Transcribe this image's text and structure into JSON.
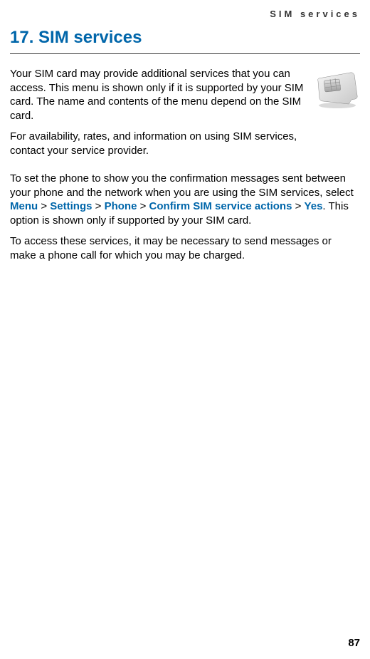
{
  "header": {
    "section_label": "SIM services"
  },
  "title": "17. SIM services",
  "paragraphs": {
    "p1": "Your SIM card may provide additional services that you can access. This menu is shown only if it is supported by your SIM card. The name and contents of the menu depend on the SIM card.",
    "p2": "For availability, rates, and information on using SIM services, contact your service provider.",
    "p3_pre": "To set the phone to show you the confirmation messages sent between your phone and the network when you are using the SIM services, select ",
    "p3_menu1": "Menu",
    "p3_sep1": " > ",
    "p3_menu2": "Settings",
    "p3_sep2": " > ",
    "p3_menu3": "Phone",
    "p3_sep3": " > ",
    "p3_menu4": "Confirm SIM service actions",
    "p3_sep4": " > ",
    "p3_menu5": "Yes",
    "p3_post": ". This option is shown only if supported by your SIM card.",
    "p4": "To access these services, it may be necessary to send messages or make a phone call for which you may be charged."
  },
  "page_number": "87",
  "icon": {
    "name": "sim-card-icon"
  }
}
